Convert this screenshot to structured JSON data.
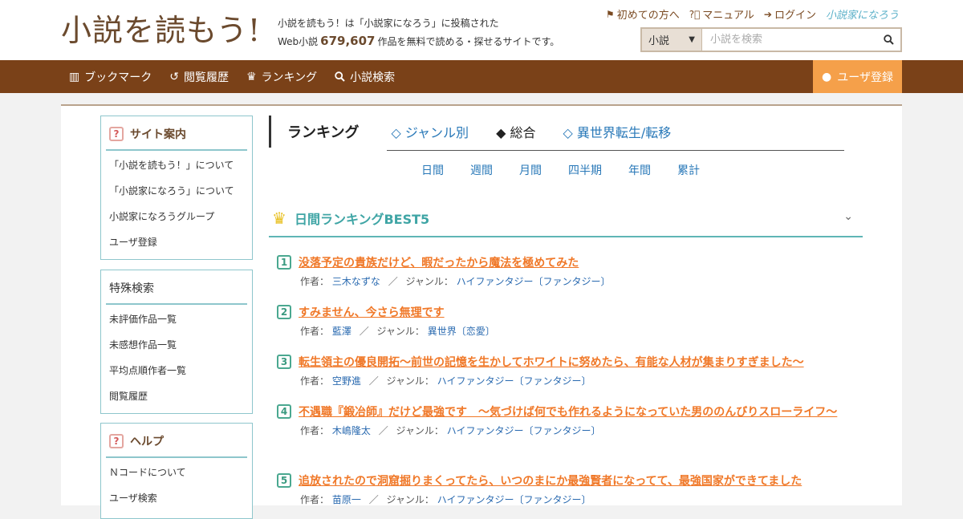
{
  "header": {
    "logo": "小説を読もう!",
    "tagline_line1": "小説を読もう！は「小説家になろう」に投稿された",
    "tagline_pre": "Web小説",
    "tagline_count": "679,607",
    "tagline_post": "作品を無料で読める・探せるサイトです。",
    "toplinks": [
      {
        "label": "初めての方へ",
        "icon": "beginner-icon"
      },
      {
        "label": "マニュアル",
        "icon": "question-icon"
      },
      {
        "label": "ログイン",
        "icon": "login-icon"
      }
    ],
    "partner_logo": "小説家になろう",
    "search": {
      "select_value": "小説",
      "placeholder": "小説を検索"
    }
  },
  "nav": {
    "items": [
      {
        "label": "ブックマーク",
        "icon": "bookmark-icon"
      },
      {
        "label": "閲覧履歴",
        "icon": "history-icon"
      },
      {
        "label": "ランキング",
        "icon": "crown-icon"
      },
      {
        "label": "小説検索",
        "icon": "search-icon"
      }
    ],
    "register": "ユーザ登録"
  },
  "sidebar": {
    "guide": {
      "title": "サイト案内",
      "items": [
        "「小説を読もう！」について",
        "「小説家になろう」について",
        "小説家になろうグループ",
        "ユーザ登録"
      ]
    },
    "special": {
      "title": "特殊検索",
      "items": [
        "未評価作品一覧",
        "未感想作品一覧",
        "平均点順作者一覧",
        "閲覧履歴"
      ]
    },
    "help": {
      "title": "ヘルプ",
      "items": [
        "Ｎコードについて",
        "ユーザ検索"
      ]
    }
  },
  "ranking": {
    "title": "ランキング",
    "tabs": [
      {
        "label": "◇ ジャンル別",
        "active": false
      },
      {
        "label": "◆ 総合",
        "active": true
      },
      {
        "label": "◇ 異世界転生/転移",
        "active": false
      }
    ],
    "periods": [
      "日間",
      "週間",
      "月間",
      "四半期",
      "年間",
      "累計"
    ],
    "best_title": "日間ランキングBEST5",
    "author_label": "作者：",
    "genre_label": "ジャンル：",
    "entries": [
      {
        "rank": "1",
        "title": "没落予定の貴族だけど、暇だったから魔法を極めてみた",
        "author": "三木なずな",
        "genre": "ハイファンタジー〔ファンタジー〕"
      },
      {
        "rank": "2",
        "title": "すみません、今さら無理です",
        "author": "藍澤",
        "genre": "異世界〔恋愛〕"
      },
      {
        "rank": "3",
        "title": "転生領主の優良開拓〜前世の記憶を生かしてホワイトに努めたら、有能な人材が集まりすぎました〜",
        "author": "空野進",
        "genre": "ハイファンタジー〔ファンタジー〕"
      },
      {
        "rank": "4",
        "title": "不遇職『鍛冶師』だけど最強です　～気づけば何でも作れるようになっていた男ののんびりスローライフ～",
        "author": "木嶋隆太",
        "genre": "ハイファンタジー〔ファンタジー〕"
      },
      {
        "rank": "5",
        "title": "追放されたので洞窟掘りまくってたら、いつのまにか最強賢者になってて、最強国家ができてました",
        "author": "苗原一",
        "genre": "ハイファンタジー〔ファンタジー〕"
      }
    ]
  }
}
